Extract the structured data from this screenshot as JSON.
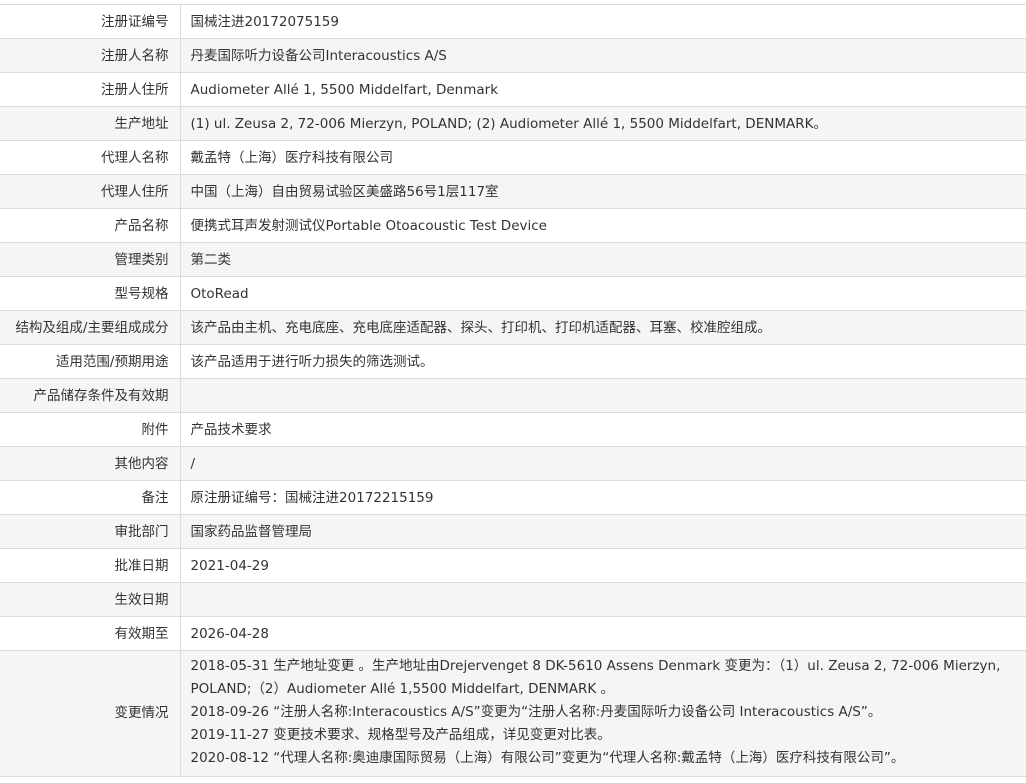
{
  "rows": [
    {
      "label": "注册证编号",
      "value": "国械注进20172075159"
    },
    {
      "label": "注册人名称",
      "value": "丹麦国际听力设备公司Interacoustics A/S"
    },
    {
      "label": "注册人住所",
      "value": "Audiometer Allé 1, 5500 Middelfart, Denmark"
    },
    {
      "label": "生产地址",
      "value": "(1) ul. Zeusa 2, 72-006 Mierzyn, POLAND; (2) Audiometer Allé 1, 5500 Middelfart, DENMARK。"
    },
    {
      "label": "代理人名称",
      "value": "戴孟特（上海）医疗科技有限公司"
    },
    {
      "label": "代理人住所",
      "value": "中国（上海）自由贸易试验区美盛路56号1层117室"
    },
    {
      "label": "产品名称",
      "value": "便携式耳声发射测试仪Portable Otoacoustic Test Device"
    },
    {
      "label": "管理类别",
      "value": "第二类"
    },
    {
      "label": "型号规格",
      "value": "OtoRead"
    },
    {
      "label": "结构及组成/主要组成成分",
      "value": "该产品由主机、充电底座、充电底座适配器、探头、打印机、打印机适配器、耳塞、校准腔组成。"
    },
    {
      "label": "适用范围/预期用途",
      "value": "该产品适用于进行听力损失的筛选测试。"
    },
    {
      "label": "产品储存条件及有效期",
      "value": ""
    },
    {
      "label": "附件",
      "value": "产品技术要求"
    },
    {
      "label": "其他内容",
      "value": "/"
    },
    {
      "label": "备注",
      "value": "原注册证编号：国械注进20172215159"
    },
    {
      "label": "审批部门",
      "value": "国家药品监督管理局"
    },
    {
      "label": "批准日期",
      "value": "2021-04-29"
    },
    {
      "label": "生效日期",
      "value": ""
    },
    {
      "label": "有效期至",
      "value": "2026-04-28"
    }
  ],
  "changes": {
    "label": "变更情况",
    "lines": [
      "2018-05-31 生产地址变更 。生产地址由Drejervenget 8 DK-5610 Assens Denmark 变更为：（1）ul. Zeusa 2, 72-006 Mierzyn, POLAND;（2）Audiometer Allé 1,5500 Middelfart, DENMARK 。",
      "2018-09-26 “注册人名称:Interacoustics A/S”变更为“注册人名称:丹麦国际听力设备公司 Interacoustics A/S”。",
      "2019-11-27 变更技术要求、规格型号及产品组成，详见变更对比表。",
      "2020-08-12 “代理人名称:奥迪康国际贸易（上海）有限公司”变更为“代理人名称:戴孟特（上海）医疗科技有限公司”。"
    ]
  }
}
